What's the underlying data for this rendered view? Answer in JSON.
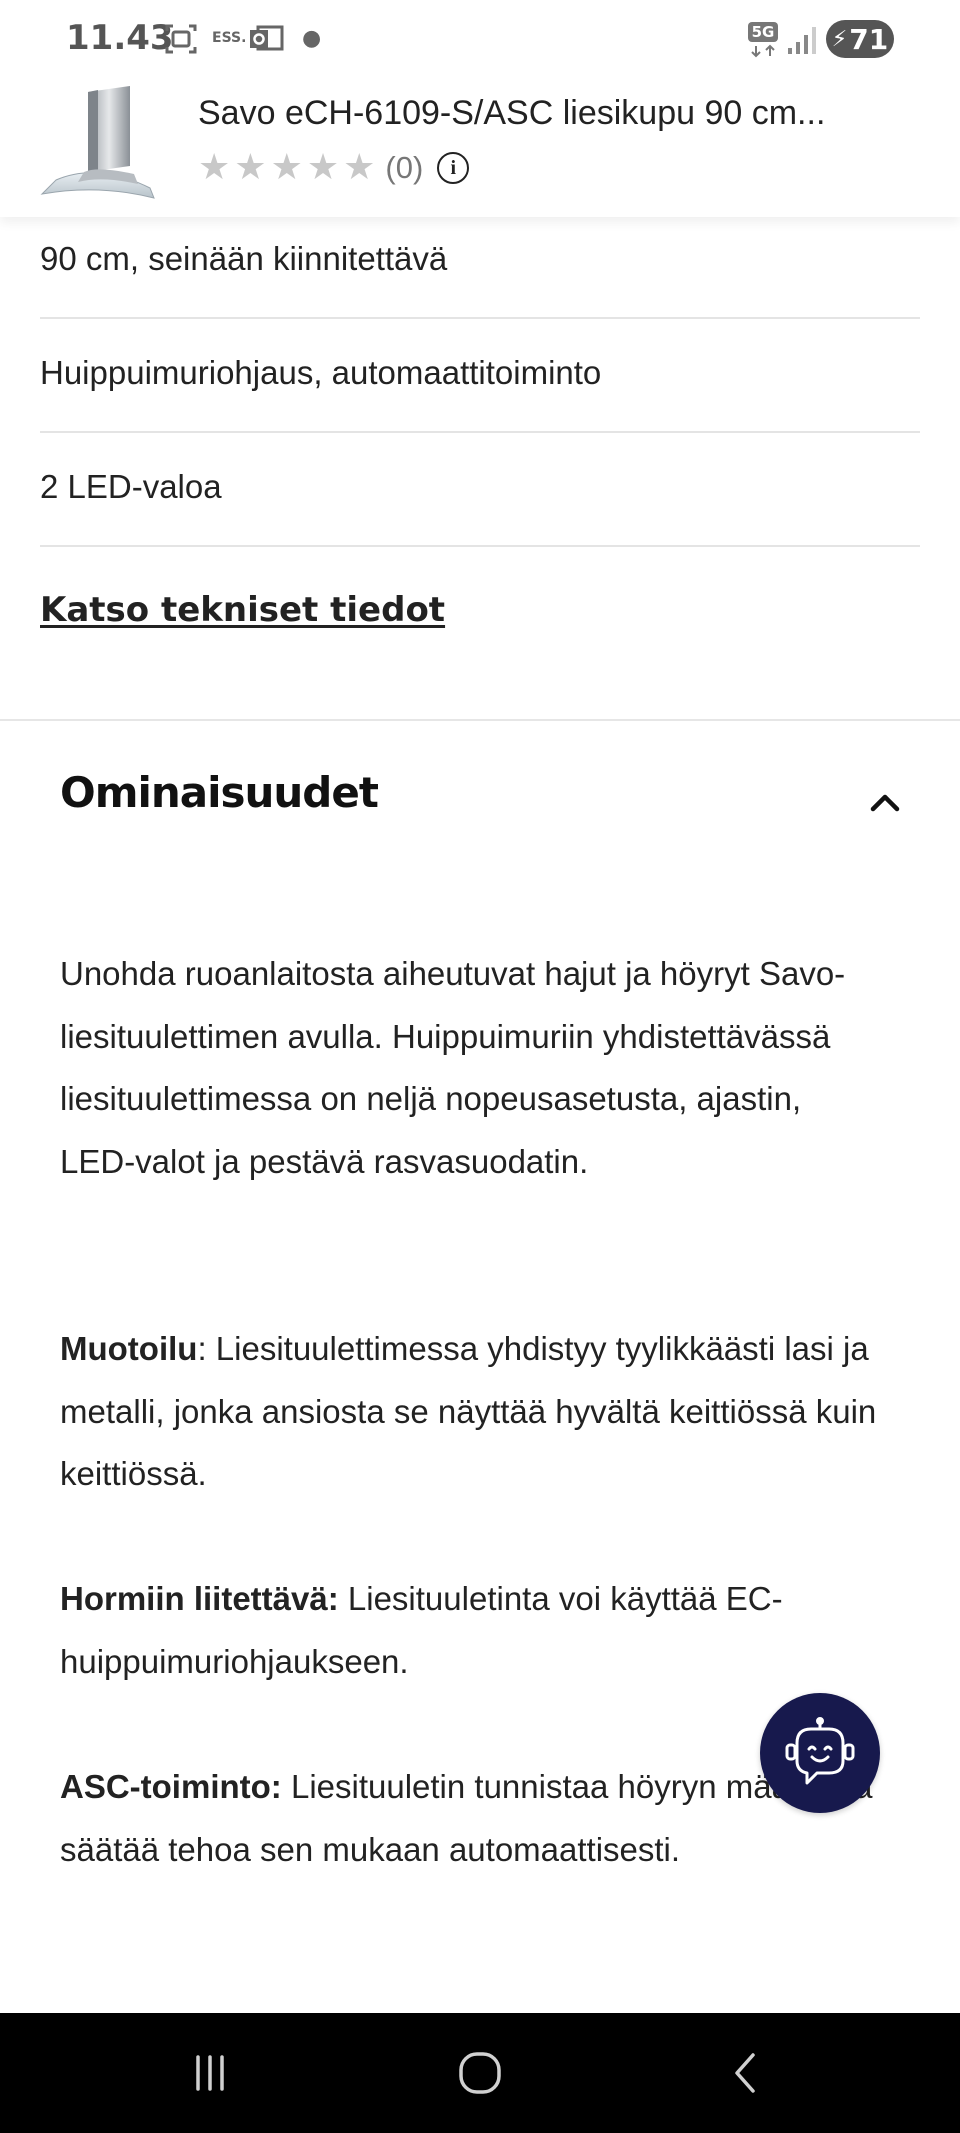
{
  "status_bar": {
    "time": "11.43",
    "icons": [
      "screenshot-icon",
      "ess-icon",
      "outlook-icon",
      "dot-icon",
      "5g-icon",
      "signal-icon"
    ],
    "network": "5G",
    "ess_label": "ESS.",
    "battery": "71"
  },
  "product": {
    "title": "Savo eCH-6109-S/ASC liesikupu 90 cm...",
    "rating_stars": 0,
    "review_count": "(0)"
  },
  "specs": [
    "90 cm, seinään kiinnitettävä",
    "Huippuimuriohjaus, automaattitoiminto",
    "2 LED-valoa"
  ],
  "tech_link": "Katso tekniset tiedot",
  "features_section": {
    "title": "Ominaisuudet",
    "intro": "Unohda ruoanlaitosta aiheutuvat hajut ja höyryt Savo-liesituulettimen avulla. Huippuimuriin yhdistettävässä liesituulettimessa on neljä nopeusasetusta, ajastin, LED-valot ja pestävä rasvasuodatin.",
    "paragraphs": [
      {
        "label": "Muotoilu",
        "text": ": Liesituulettimessa yhdistyy tyylikkäästi lasi ja metalli, jonka ansiosta se näyttää hyvältä keittiössä kuin keittiössä."
      },
      {
        "label": "Hormiin liitettävä:",
        "text": " Liesituuletinta voi käyttää EC-huippuimuriohjaukseen."
      },
      {
        "label": "ASC-toiminto:",
        "text": " Liesituuletin tunnistaa höyryn määrän ja säätää tehoa sen mukaan automaattisesti."
      }
    ]
  },
  "colors": {
    "chat_bot_bg": "#17194d",
    "nav_bar_bg": "#000000"
  }
}
